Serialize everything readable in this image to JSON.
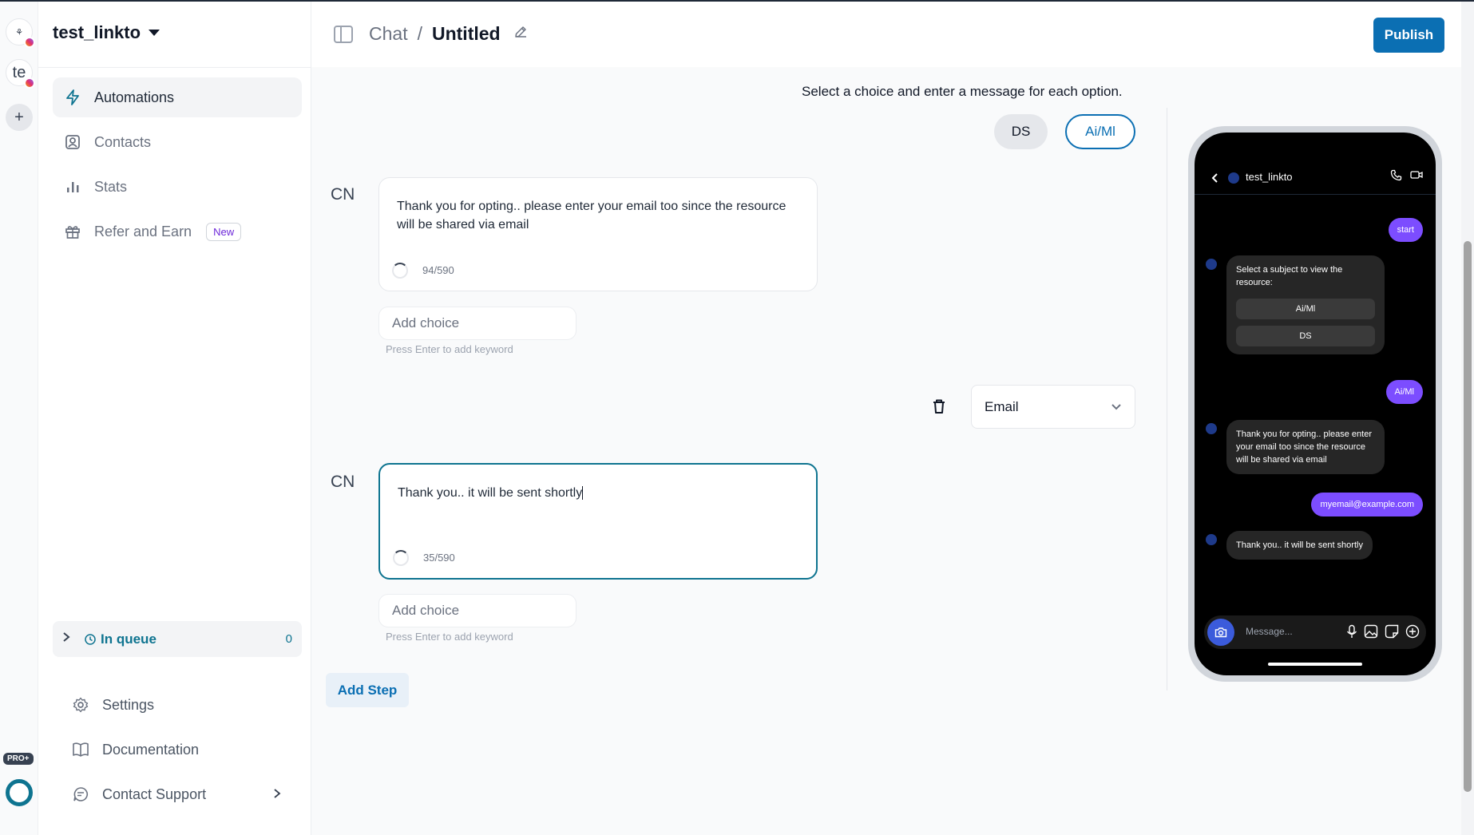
{
  "rail": {
    "accounts": [
      {
        "initials": "",
        "platform": "instagram"
      },
      {
        "initials": "te",
        "platform": "instagram"
      }
    ],
    "add_label": "+",
    "plan_badge": "PRO+"
  },
  "sidebar": {
    "account_name": "test_linkto",
    "items": [
      {
        "label": "Automations",
        "icon": "bolt-icon",
        "active": true
      },
      {
        "label": "Contacts",
        "icon": "contact-icon"
      },
      {
        "label": "Stats",
        "icon": "bar-chart-icon"
      },
      {
        "label": "Refer and Earn",
        "icon": "gift-icon",
        "badge": "New"
      }
    ],
    "queue": {
      "label": "In queue",
      "count": "0"
    },
    "bottom_items": [
      {
        "label": "Settings",
        "icon": "gear-icon"
      },
      {
        "label": "Documentation",
        "icon": "book-icon"
      },
      {
        "label": "Contact Support",
        "icon": "chat-support-icon"
      }
    ]
  },
  "header": {
    "breadcrumb_root": "Chat",
    "breadcrumb_sep": "/",
    "title": "Untitled",
    "publish_label": "Publish"
  },
  "editor": {
    "instruction": "Select a choice and enter a message for each option.",
    "choices": [
      "DS",
      "Ai/Ml"
    ],
    "selected_choice": "Ai/Ml",
    "steps": [
      {
        "avatar": "CN",
        "message": "Thank you for opting.. please enter your email too since the resource will be shared via email",
        "counter": "94/590",
        "add_choice_placeholder": "Add choice",
        "hint": "Press Enter to add keyword"
      },
      {
        "avatar": "CN",
        "message": "Thank you.. it will be sent shortly",
        "counter": "35/590",
        "add_choice_placeholder": "Add choice",
        "hint": "Press Enter to add keyword"
      }
    ],
    "response_type": "Email",
    "add_step_label": "Add Step"
  },
  "preview": {
    "contact_name": "test_linkto",
    "messages": [
      {
        "from": "user",
        "text": "start"
      },
      {
        "from": "bot",
        "text": "Select a subject to view the resource:",
        "buttons": [
          "Ai/Ml",
          "DS"
        ]
      },
      {
        "from": "user",
        "text": "Ai/Ml"
      },
      {
        "from": "bot",
        "text": "Thank you for opting.. please enter your email too since the resource will be shared via email"
      },
      {
        "from": "user",
        "text": "myemail@example.com"
      },
      {
        "from": "bot",
        "text": "Thank you.. it will be sent shortly"
      }
    ],
    "input_placeholder": "Message..."
  },
  "colors": {
    "brand": "#0b6fb3",
    "accent": "#0e7490",
    "bubble_out": "#7c4dff"
  }
}
